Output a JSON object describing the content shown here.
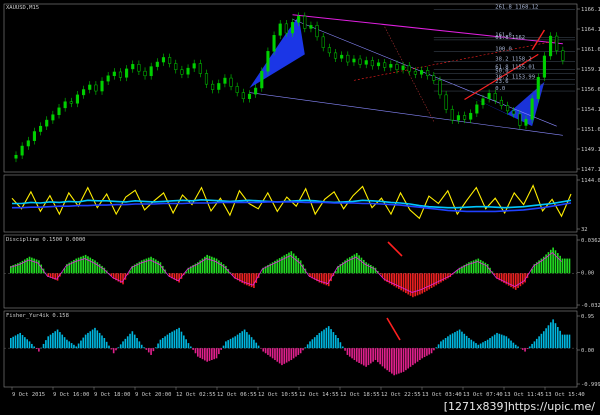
{
  "title": "XAUUSD,M15",
  "colors": {
    "background": "#000000",
    "grid": "#3a3a3a",
    "frame": "#8a8a8a",
    "candle_up": "#00d000",
    "candle_down": "#00d000",
    "harmonic_fill": "#1e3cff",
    "magenta": "#e020e0",
    "red": "#ff2020",
    "yellow": "#ffee00",
    "cyan": "#00c8ff",
    "blue": "#2040ff",
    "green_bar": "#22dd22",
    "red_bar": "#ee2020",
    "teal_bar": "#00b8e0",
    "pink_bar": "#e0208c",
    "axis_text": "#cfcfcf"
  },
  "panes": [
    {
      "id": "price",
      "label": "XAUUSD,M15"
    },
    {
      "id": "oscillator",
      "label": ""
    },
    {
      "id": "discipline",
      "label": "Discipline 0.1500 0.0000"
    },
    {
      "id": "fisher",
      "label": "Fisher_Yur4ik 0.158"
    }
  ],
  "price_axis_ticks": [
    "1166.10",
    "1164.10",
    "1161.60",
    "1159.10",
    "1156.60",
    "1154.10",
    "1151.60",
    "1149.10",
    "1147.10"
  ],
  "oscillator_axis_ticks": [
    "1144.05",
    "32"
  ],
  "discipline_axis_ticks": [
    "0.0362",
    "0.00",
    "-0.0323"
  ],
  "fisher_axis_ticks": [
    "0.95",
    "0.00",
    "-0.999"
  ],
  "time_labels": [
    "9 Oct 2015",
    "9 Oct 16:00",
    "9 Oct 18:00",
    "9 Oct 20:00",
    "12 Oct 02:55",
    "12 Oct 06:55",
    "12 Oct 10:55",
    "12 Oct 14:55",
    "12 Oct 18:55",
    "12 Oct 22:55",
    "13 Oct 03:40",
    "13 Oct 07:40",
    "13 Oct 11:45",
    "13 Oct 15:40"
  ],
  "fib_labels": [
    "261.8 1168.12",
    "161.8",
    "61.8 1162",
    "100.0",
    "38.2 1158.2",
    "61.8 1155.01",
    "50.0",
    "38.2 1153.99",
    "23.6",
    "0.0"
  ],
  "watermark": {
    "size": "[1271x839]",
    "site": "https://upic.me/"
  },
  "chart_data": [
    {
      "type": "candlestick",
      "title": "XAUUSD,M15",
      "ylim": [
        1146,
        1168
      ],
      "close": [
        1148.2,
        1149.4,
        1150.1,
        1151.3,
        1152.0,
        1152.8,
        1153.5,
        1154.4,
        1155.2,
        1155.0,
        1156.1,
        1156.8,
        1157.4,
        1156.6,
        1157.9,
        1158.6,
        1159.1,
        1158.4,
        1159.5,
        1160.1,
        1159.2,
        1158.6,
        1159.8,
        1160.4,
        1161.0,
        1160.2,
        1159.4,
        1158.8,
        1159.6,
        1160.2,
        1158.9,
        1157.5,
        1156.8,
        1157.6,
        1158.3,
        1157.2,
        1156.4,
        1155.6,
        1156.2,
        1157.0,
        1159.2,
        1161.8,
        1163.9,
        1165.4,
        1164.2,
        1165.6,
        1166.4,
        1164.8,
        1165.2,
        1163.7,
        1162.3,
        1161.6,
        1160.9,
        1161.3,
        1160.4,
        1160.8,
        1160.1,
        1160.6,
        1159.9,
        1160.3,
        1159.7,
        1160.1,
        1159.4,
        1159.9,
        1159.2,
        1158.8,
        1159.3,
        1158.6,
        1158.0,
        1156.1,
        1154.2,
        1152.8,
        1153.4,
        1152.9,
        1153.7,
        1154.8,
        1155.6,
        1156.3,
        1155.4,
        1154.7,
        1154.0,
        1153.6,
        1152.1,
        1152.9,
        1155.6,
        1158.4,
        1161.2,
        1163.8,
        1161.9,
        1160.6
      ],
      "open": [
        1147.8,
        1148.2,
        1149.4,
        1150.1,
        1151.3,
        1152.0,
        1152.8,
        1153.5,
        1154.4,
        1155.2,
        1155.0,
        1156.1,
        1156.8,
        1157.4,
        1156.6,
        1157.9,
        1158.6,
        1159.1,
        1158.4,
        1159.5,
        1160.1,
        1159.2,
        1158.6,
        1159.8,
        1160.4,
        1161.0,
        1160.2,
        1159.4,
        1158.8,
        1159.6,
        1160.2,
        1158.9,
        1157.5,
        1156.8,
        1157.6,
        1158.3,
        1157.2,
        1156.4,
        1155.6,
        1156.2,
        1157.0,
        1159.2,
        1161.8,
        1163.9,
        1165.4,
        1164.2,
        1165.6,
        1166.4,
        1164.8,
        1165.2,
        1163.7,
        1162.3,
        1161.6,
        1160.9,
        1161.3,
        1160.4,
        1160.8,
        1160.1,
        1160.6,
        1159.9,
        1160.3,
        1159.7,
        1160.1,
        1159.4,
        1159.9,
        1159.2,
        1158.8,
        1159.3,
        1158.6,
        1158.0,
        1156.1,
        1154.2,
        1152.8,
        1153.4,
        1152.9,
        1153.7,
        1154.8,
        1155.6,
        1156.3,
        1155.4,
        1154.7,
        1154.0,
        1153.6,
        1152.1,
        1152.9,
        1155.6,
        1158.4,
        1161.2,
        1163.8,
        1161.9
      ]
    },
    {
      "type": "line",
      "title": "",
      "ylim": [
        0,
        100
      ],
      "series": [
        {
          "values": [
            60,
            40,
            72,
            35,
            65,
            30,
            70,
            45,
            80,
            42,
            68,
            30,
            62,
            75,
            38,
            55,
            70,
            32,
            66,
            48,
            80,
            36,
            60,
            28,
            74,
            50,
            40,
            70,
            35,
            62,
            45,
            78,
            30,
            58,
            72,
            40,
            65,
            82,
            42,
            60,
            30,
            70,
            38,
            22,
            64,
            50,
            74,
            30,
            56,
            80,
            40,
            60,
            32,
            70,
            48,
            84,
            36,
            58,
            26,
            68
          ]
        },
        {
          "values": [
            50,
            50,
            52,
            51,
            53,
            52,
            54,
            53,
            56,
            55,
            55,
            54,
            53,
            55,
            54,
            53,
            54,
            55,
            56,
            55,
            57,
            56,
            55,
            54,
            55,
            56,
            55,
            54,
            53,
            54,
            55,
            56,
            55,
            53,
            52,
            53,
            54,
            56,
            55,
            54,
            52,
            51,
            49,
            46,
            44,
            43,
            42,
            42,
            43,
            44,
            44,
            43,
            42,
            43,
            44,
            46,
            48,
            50,
            53,
            56
          ]
        },
        {
          "values": [
            42,
            42,
            43,
            43,
            44,
            45,
            45,
            46,
            46,
            47,
            47,
            48,
            48,
            49,
            49,
            49,
            50,
            50,
            50,
            51,
            51,
            51,
            52,
            52,
            52,
            52,
            52,
            53,
            53,
            53,
            53,
            52,
            52,
            52,
            51,
            51,
            51,
            50,
            50,
            49,
            48,
            47,
            45,
            43,
            41,
            39,
            37,
            36,
            35,
            35,
            35,
            35,
            36,
            37,
            38,
            40,
            42,
            45,
            48,
            51
          ]
        }
      ]
    },
    {
      "type": "bar",
      "title": "Discipline 0.1500 0.0000",
      "ylim": [
        -0.0323,
        0.0362
      ],
      "values": [
        0.008,
        0.012,
        0.018,
        0.014,
        -0.004,
        -0.008,
        0.01,
        0.016,
        0.02,
        0.014,
        0.006,
        -0.006,
        -0.012,
        0.008,
        0.014,
        0.018,
        0.012,
        -0.004,
        -0.01,
        0.006,
        0.012,
        0.02,
        0.016,
        0.008,
        -0.006,
        -0.012,
        -0.016,
        0.006,
        0.012,
        0.018,
        0.024,
        0.014,
        -0.004,
        -0.01,
        -0.014,
        0.008,
        0.016,
        0.022,
        0.012,
        0.006,
        -0.008,
        -0.014,
        -0.02,
        -0.026,
        -0.022,
        -0.016,
        -0.01,
        -0.004,
        0.006,
        0.012,
        0.016,
        0.01,
        -0.006,
        -0.012,
        -0.018,
        -0.01,
        0.01,
        0.018,
        0.028,
        0.016
      ]
    },
    {
      "type": "bar",
      "title": "Fisher_Yur4ik 0.158",
      "ylim": [
        -0.999,
        0.95
      ],
      "values": [
        0.3,
        0.45,
        0.2,
        -0.1,
        0.35,
        0.55,
        0.25,
        0.05,
        0.4,
        0.6,
        0.3,
        -0.15,
        0.2,
        0.5,
        0.1,
        -0.2,
        0.25,
        0.45,
        0.6,
        0.15,
        -0.25,
        -0.4,
        -0.3,
        0.2,
        0.35,
        0.55,
        0.25,
        -0.1,
        -0.3,
        -0.5,
        -0.35,
        -0.15,
        0.2,
        0.45,
        0.65,
        0.3,
        -0.2,
        -0.4,
        -0.55,
        -0.35,
        -0.6,
        -0.8,
        -0.7,
        -0.5,
        -0.3,
        -0.15,
        0.2,
        0.4,
        0.55,
        0.3,
        0.1,
        0.25,
        0.45,
        0.35,
        0.1,
        -0.1,
        0.2,
        0.5,
        0.85,
        0.4
      ]
    }
  ]
}
